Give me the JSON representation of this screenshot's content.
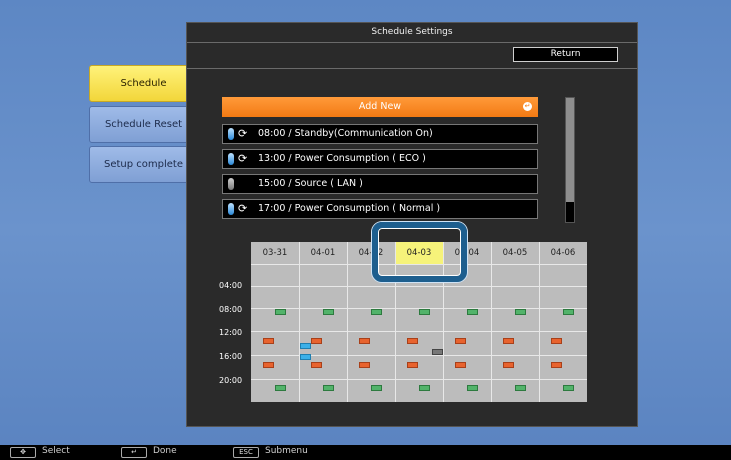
{
  "panel": {
    "title": "Schedule Settings",
    "return_label": "Return"
  },
  "menu": [
    {
      "label": "Schedule",
      "active": true
    },
    {
      "label": "Schedule Reset",
      "active": false
    },
    {
      "label": "Setup complete",
      "active": false
    }
  ],
  "schedule": {
    "add_new_label": "Add New",
    "entries": [
      {
        "text": "08:00 / Standby(Communication On)",
        "enabled": true,
        "repeat": true
      },
      {
        "text": "13:00 / Power Consumption ( ECO )",
        "enabled": true,
        "repeat": true
      },
      {
        "text": "15:00 / Source ( LAN )",
        "enabled": false,
        "repeat": false
      },
      {
        "text": "17:00 / Power Consumption ( Normal )",
        "enabled": true,
        "repeat": true
      }
    ],
    "scrollbar_position": 0.0
  },
  "calendar": {
    "dates": [
      "03-31",
      "04-01",
      "04-02",
      "04-03",
      "04-04",
      "04-05",
      "04-06"
    ],
    "selected_date": "04-03",
    "time_labels": [
      "04:00",
      "08:00",
      "12:00",
      "16:00",
      "20:00"
    ],
    "event_colors": {
      "standby": "#52b36a",
      "power": "#e8632e",
      "lan": "#3bb0e8",
      "disabled": "#777777"
    }
  },
  "footer": {
    "select_key": "✥",
    "select_label": "Select",
    "done_key": "↵",
    "done_label": "Done",
    "submenu_key": "ESC",
    "submenu_label": "Submenu"
  }
}
